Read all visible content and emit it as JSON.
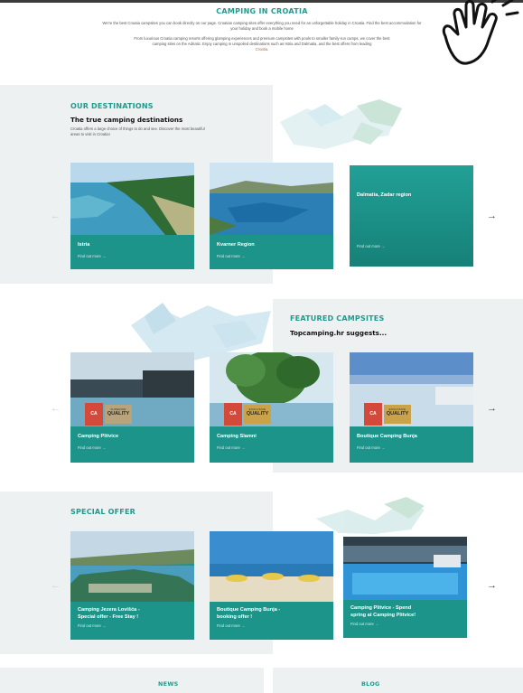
{
  "intro": {
    "title": "CAMPING IN CROATIA",
    "p1": "We're the best Croatia campsites you can book directly on our page. Croatian camping sites offer everything you need for an unforgettable holiday in Croatia. Find the best accommodation for",
    "p1b": "your holiday and book a mobile home",
    "p2": "From luxurious Croatia camping resorts offering glamping experiences and premium campsites with pools to smaller family-run camps, we cover the best",
    "p2b": "camping sites on the Adriatic. Enjoy camping in unspoiled destinations such as Istria and Dalmatia, and the best offers from leading",
    "p2c": "Croatia."
  },
  "destinations": {
    "title": "OUR DESTINATIONS",
    "subtitle": "The true camping destinations",
    "desc": "Croatia offers a large choice of things to do and see. Discover the most beautiful areas to visit in Croatia!",
    "arrow_left": "←",
    "arrow_right": "→",
    "cards": [
      {
        "name": "Istria",
        "more": "Find out more  →"
      },
      {
        "name": "Kvarner Region",
        "more": "Find out more  →"
      },
      {
        "name": "Dalmatia, Zadar region",
        "more": "Find out more  →"
      }
    ]
  },
  "featured": {
    "title": "FEATURED CAMPSITES",
    "subtitle": "Topcamping.hr suggests...",
    "arrow_left": "←",
    "arrow_right": "→",
    "cards": [
      {
        "name": "Camping Plitvice",
        "badge_top": "SUPERIOR",
        "badge_main": "QUALITY",
        "badge_logo": "CA",
        "more": "Find out more  →"
      },
      {
        "name": "Camping Slamni",
        "badge_top": "EXCLUSIVE",
        "badge_main": "QUALITY",
        "badge_logo": "CA",
        "more": "Find out more  →"
      },
      {
        "name": "Boutique Camping Bunja",
        "badge_top": "EXCLUSIVE",
        "badge_main": "QUALITY",
        "badge_logo": "CA",
        "more": "Find out more  →"
      }
    ]
  },
  "special": {
    "title": "SPECIAL OFFER",
    "arrow_left": "←",
    "arrow_right": "→",
    "cards": [
      {
        "name1": "Camping Jezera Lovišća -",
        "name2": "Special offer - Free Stay !",
        "more": "Find out more  →"
      },
      {
        "name1": "Boutique Camping Bunja -",
        "name2": "booking offer !",
        "more": "Find out more  →"
      },
      {
        "name1": "Camping Plitvice - Spend",
        "name2": "spring at Camping Plitvice!",
        "more": "Find out more  →"
      }
    ]
  },
  "footer": {
    "news": "NEWS",
    "blog": "BLOG"
  },
  "colors": {
    "accent": "#1e9b8f",
    "card": "#1d948a",
    "badge_gold": "#c9a24a",
    "badge_tan": "#b7a47c",
    "section_bg": "#eef1f2"
  }
}
